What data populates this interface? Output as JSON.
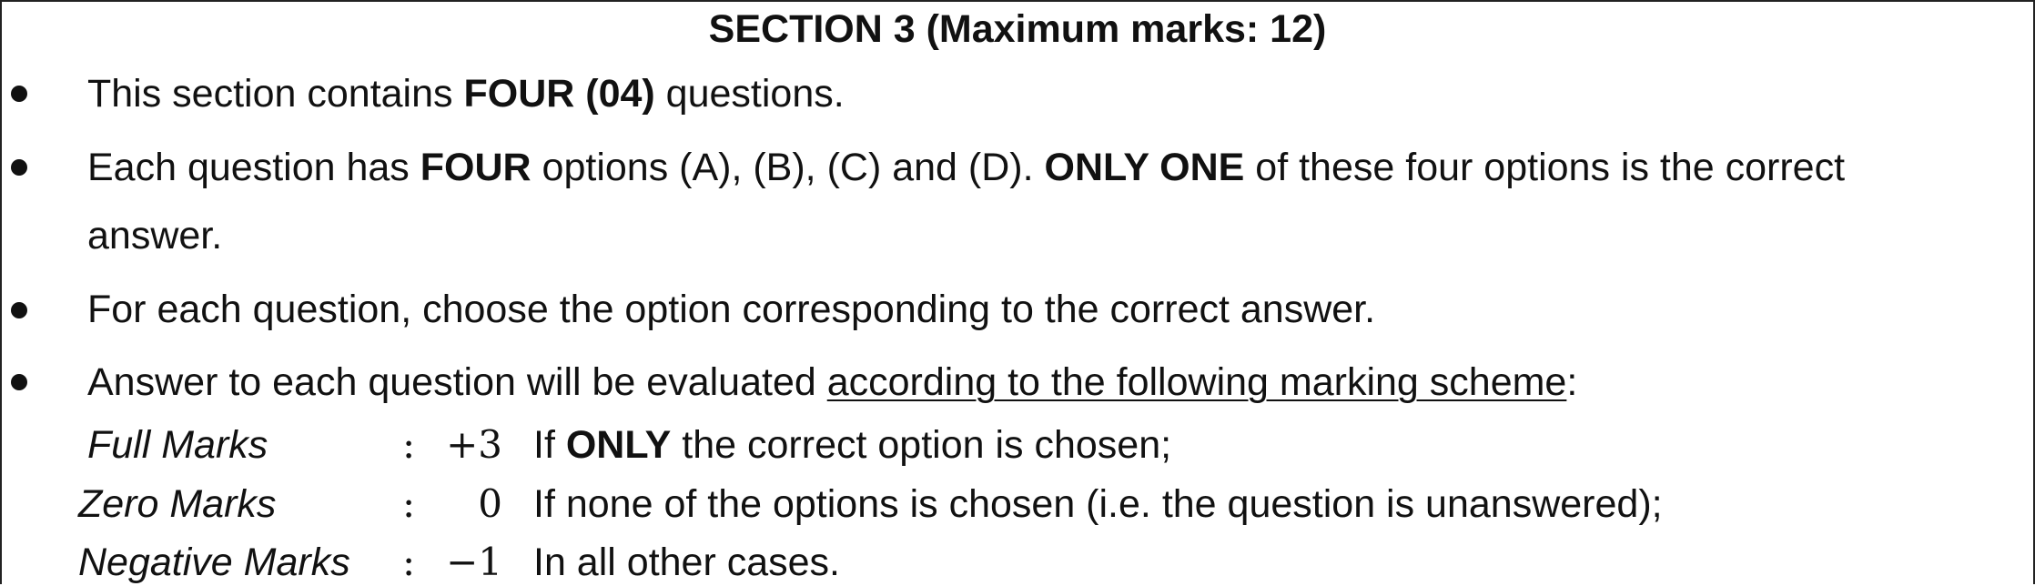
{
  "section": {
    "title": "SECTION 3 (Maximum marks: 12)"
  },
  "instructions": {
    "item1": {
      "pre": "This section contains ",
      "bold": "FOUR (04)",
      "post": " questions."
    },
    "item2": {
      "pre": "Each question has ",
      "bold1": "FOUR",
      "mid": " options (A), (B), (C) and (D). ",
      "bold2": "ONLY ONE",
      "post": " of these four options is the correct",
      "cont": "answer."
    },
    "item3": {
      "text": "For each question, choose the option corresponding to the correct answer."
    },
    "item4": {
      "pre": "Answer to each question will be evaluated ",
      "underlined": "according to the following marking scheme",
      "post": ":"
    }
  },
  "marking_scheme": {
    "colon": ":",
    "full": {
      "label": "Full Marks",
      "value": "+3",
      "desc_pre": "If ",
      "desc_bold": "ONLY",
      "desc_post": " the correct option is chosen;"
    },
    "zero": {
      "label": "Zero Marks",
      "value": "0",
      "desc": "If none of the options is chosen (i.e. the question is unanswered);"
    },
    "negative": {
      "label": "Negative Marks",
      "value": "−1",
      "desc": "In all other cases."
    }
  }
}
